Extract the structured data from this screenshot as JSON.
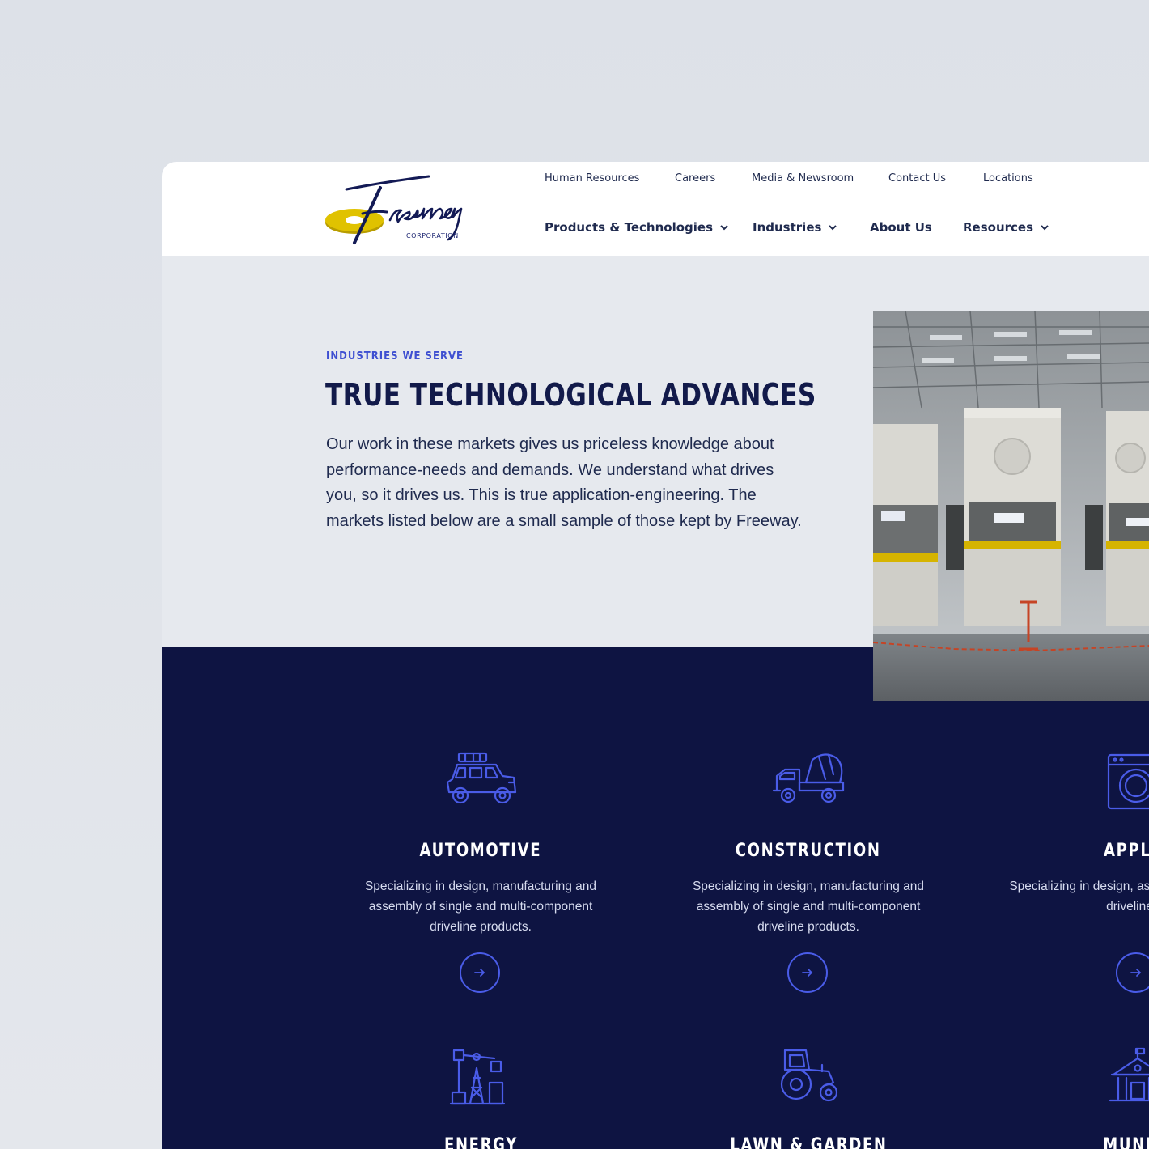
{
  "brand": {
    "logo_script": "Freeway",
    "logo_sub": "CORPORATION",
    "colors": {
      "navy": "#0e1442",
      "accent": "#3e4fd1",
      "gold": "#e0c200"
    }
  },
  "utility_nav": [
    "Human Resources",
    "Careers",
    "Media & Newsroom",
    "Contact Us",
    "Locations"
  ],
  "main_nav": [
    {
      "label": "Products & Technologies",
      "has_dropdown": true
    },
    {
      "label": "Industries",
      "has_dropdown": true
    },
    {
      "label": "About Us",
      "has_dropdown": false
    },
    {
      "label": "Resources",
      "has_dropdown": true
    }
  ],
  "hero": {
    "eyebrow": "INDUSTRIES WE SERVE",
    "title": "TRUE TECHNOLOGICAL ADVANCES",
    "text": "Our work in these markets gives us priceless knowledge about performance-needs and demands. We understand what drives you, so it drives us. This is true application-engineering. The markets listed below are a small sample of those kept by Freeway.",
    "image": "factory-press-machines-photo"
  },
  "industries": [
    {
      "title": "AUTOMOTIVE",
      "icon": "car-icon",
      "desc": "Specializing in design, manufacturing and assembly of single and multi-component driveline products."
    },
    {
      "title": "CONSTRUCTION",
      "icon": "cement-mixer-icon",
      "desc": "Specializing in design, manufacturing and assembly of single and multi-component driveline products."
    },
    {
      "title": "APPLIA",
      "icon": "washing-machine-icon",
      "desc": "Specializing in design, assembly of single and driveline pr"
    },
    {
      "title": "ENERGY",
      "icon": "oil-pump-icon"
    },
    {
      "title": "LAWN & GARDEN",
      "icon": "tractor-icon"
    },
    {
      "title": "MUNICI",
      "icon": "municipal-building-icon"
    }
  ]
}
